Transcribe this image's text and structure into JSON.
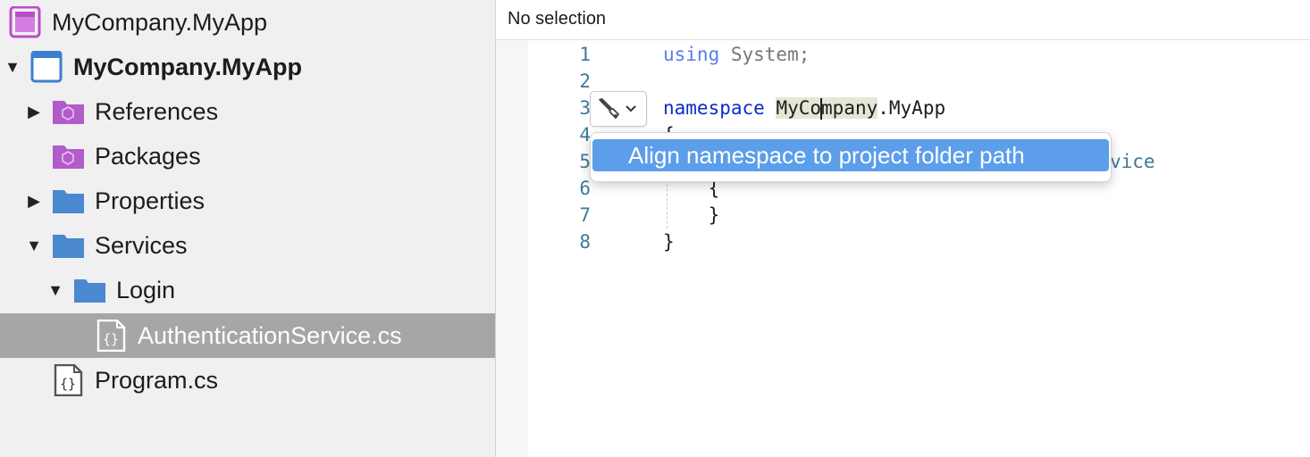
{
  "solution_explorer": {
    "items": [
      {
        "label": "MyCompany.MyApp",
        "icon": "solution-icon",
        "expander": "none"
      },
      {
        "label": "MyCompany.MyApp",
        "icon": "project-icon",
        "expander": "expanded"
      },
      {
        "label": "References",
        "icon": "references-folder-icon",
        "expander": "collapsed"
      },
      {
        "label": "Packages",
        "icon": "packages-folder-icon",
        "expander": "none"
      },
      {
        "label": "Properties",
        "icon": "folder-icon",
        "expander": "collapsed"
      },
      {
        "label": "Services",
        "icon": "folder-icon",
        "expander": "expanded"
      },
      {
        "label": "Login",
        "icon": "folder-icon",
        "expander": "expanded"
      },
      {
        "label": "AuthenticationService.cs",
        "icon": "csharp-file-icon",
        "expander": "none",
        "selected": true
      },
      {
        "label": "Program.cs",
        "icon": "csharp-file-icon",
        "expander": "none"
      }
    ]
  },
  "editor": {
    "status": "No selection",
    "line_numbers": [
      "1",
      "2",
      "3",
      "4",
      "5",
      "6",
      "7",
      "8"
    ],
    "code": {
      "line1_kw": "using",
      "line1_rest": " System;",
      "line3_kw": "namespace",
      "line3_ns_a": "MyCo",
      "line3_ns_b": "mpany",
      "line3_rest": ".MyApp",
      "line4": "{",
      "line5_tail": "vice",
      "line6": "    {",
      "line7": "    }",
      "line8": "}"
    }
  },
  "quick_fix": {
    "icon": "screwdriver-wrench-icon",
    "menu_items": [
      {
        "label": "Align namespace to project folder path"
      }
    ]
  },
  "colors": {
    "keyword": "#0b2cc9",
    "selection": "#5c9eea",
    "line_number": "#3d7a9a",
    "folder": "#4a88d0",
    "package_folder": "#b15cc9"
  }
}
